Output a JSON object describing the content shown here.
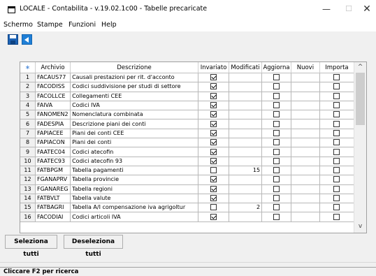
{
  "window": {
    "title": "LOCALE - Contabilita - v.19.02.1c00 - Tabelle precaricate",
    "minimize_glyph": "—",
    "maximize_glyph": "☐",
    "close_glyph": "✕"
  },
  "menu": {
    "items": [
      "Schermo",
      "Stampe",
      "Funzioni",
      "Help"
    ]
  },
  "toolbar": {
    "icons": [
      "save-icon",
      "back-icon"
    ]
  },
  "grid": {
    "headers": [
      "∗",
      "Archivio",
      "Descrizione",
      "Invariato",
      "Modificati",
      "Aggiorna",
      "Nuovi",
      "Importa"
    ],
    "rows": [
      {
        "n": "1",
        "archivio": "FACAUS77",
        "descr": "Causali prestazioni per rit. d'acconto",
        "invariato": true,
        "modificati": "",
        "aggiorna": false,
        "importa": false
      },
      {
        "n": "2",
        "archivio": "FACODISS",
        "descr": "Codici suddivisione per studi di settore",
        "invariato": true,
        "modificati": "",
        "aggiorna": false,
        "importa": false
      },
      {
        "n": "3",
        "archivio": "FACOLLCE",
        "descr": "Collegamenti CEE",
        "invariato": true,
        "modificati": "",
        "aggiorna": false,
        "importa": false
      },
      {
        "n": "4",
        "archivio": "FAIVA",
        "descr": "Codici IVA",
        "invariato": true,
        "modificati": "",
        "aggiorna": false,
        "importa": false
      },
      {
        "n": "5",
        "archivio": "FANOMEN2",
        "descr": "Nomenclatura combinata",
        "invariato": true,
        "modificati": "",
        "aggiorna": false,
        "importa": false
      },
      {
        "n": "6",
        "archivio": "FADESPIA",
        "descr": "Descrizione piani dei conti",
        "invariato": true,
        "modificati": "",
        "aggiorna": false,
        "importa": false
      },
      {
        "n": "7",
        "archivio": "FAPIACEE",
        "descr": "Piani dei conti CEE",
        "invariato": true,
        "modificati": "",
        "aggiorna": false,
        "importa": false
      },
      {
        "n": "8",
        "archivio": "FAPIACON",
        "descr": "Piani dei conti",
        "invariato": true,
        "modificati": "",
        "aggiorna": false,
        "importa": false
      },
      {
        "n": "9",
        "archivio": "FAATEC04",
        "descr": "Codici atecofin",
        "invariato": true,
        "modificati": "",
        "aggiorna": false,
        "importa": false
      },
      {
        "n": "10",
        "archivio": "FAATEC93",
        "descr": "Codici atecofin 93",
        "invariato": true,
        "modificati": "",
        "aggiorna": false,
        "importa": false
      },
      {
        "n": "11",
        "archivio": "FATBPGM",
        "descr": "Tabella pagamenti",
        "invariato": false,
        "modificati": "15",
        "aggiorna": false,
        "importa": false
      },
      {
        "n": "12",
        "archivio": "FGANAPRV",
        "descr": "Tabella provincie",
        "invariato": true,
        "modificati": "",
        "aggiorna": false,
        "importa": false
      },
      {
        "n": "13",
        "archivio": "FGANAREG",
        "descr": "Tabella regioni",
        "invariato": true,
        "modificati": "",
        "aggiorna": false,
        "importa": false
      },
      {
        "n": "14",
        "archivio": "FATBVLT",
        "descr": "Tabella valute",
        "invariato": true,
        "modificati": "",
        "aggiorna": false,
        "importa": false
      },
      {
        "n": "15",
        "archivio": "FATBAGRI",
        "descr": "Tabella A/I compensazione iva agrigoltur",
        "invariato": false,
        "modificati": "2",
        "aggiorna": false,
        "importa": false
      },
      {
        "n": "16",
        "archivio": "FACODIAI",
        "descr": "Codici articoli IVA",
        "invariato": true,
        "modificati": "",
        "aggiorna": false,
        "importa": false
      }
    ]
  },
  "buttons": {
    "select_all": "Seleziona tutti",
    "deselect_all": "Deseleziona tutti"
  },
  "status": {
    "text": "Cliccare F2 per ricerca"
  },
  "colors": {
    "accent": "#1f7fd6",
    "header_star": "#3a7fd5"
  }
}
